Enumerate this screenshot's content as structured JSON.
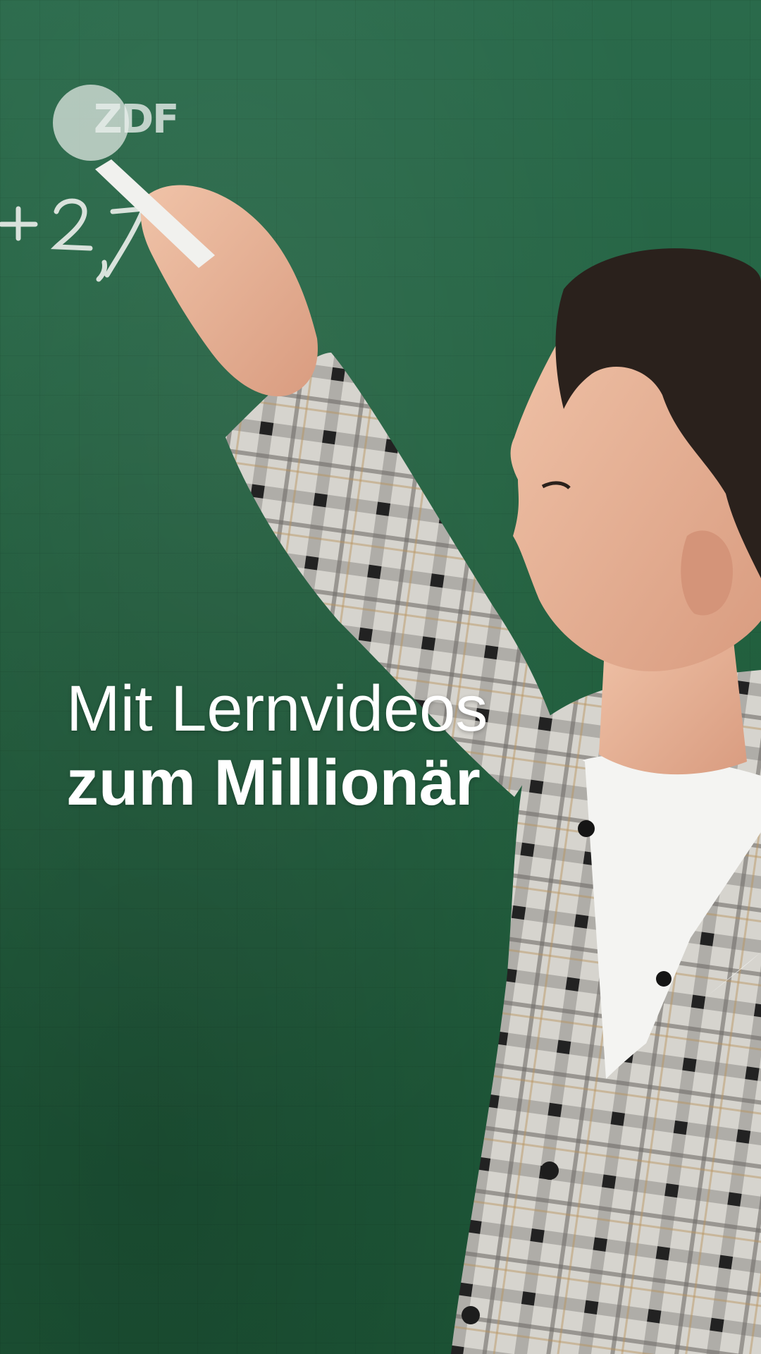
{
  "logo": {
    "text": "ZDF",
    "icon": "zdf-logo"
  },
  "chalkboard": {
    "writing": "+ 2,7"
  },
  "headline": {
    "line1": "Mit Lernvideos",
    "line2": "zum Millionär"
  },
  "colors": {
    "chalkboard": "#22603f",
    "headline": "#ffffff",
    "jacket_light": "#d8d6d0",
    "jacket_dark": "#2b2b2b",
    "skin": "#e7b59b",
    "hair": "#2a211c"
  }
}
